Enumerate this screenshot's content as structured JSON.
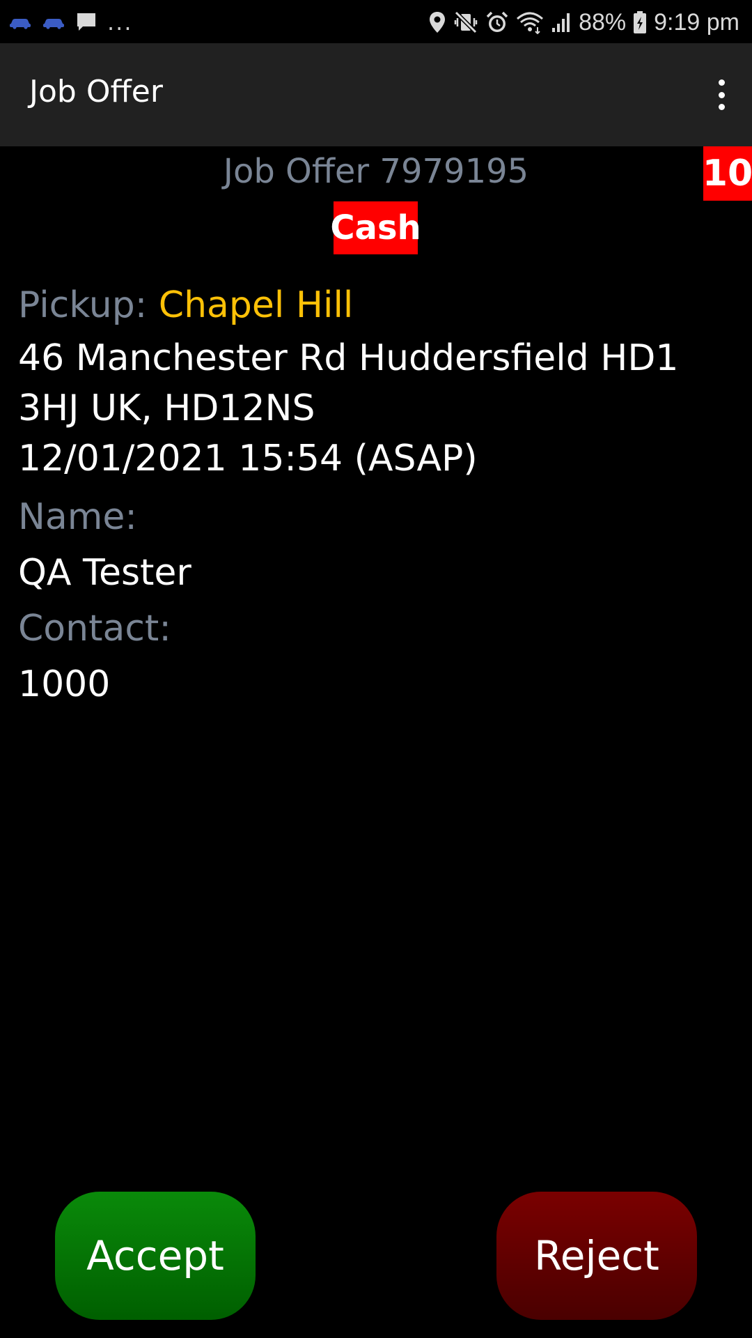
{
  "status_bar": {
    "left_icons": [
      "taxi-icon",
      "taxi-icon",
      "message-icon"
    ],
    "ellipsis": "...",
    "right_icons": [
      "location-icon",
      "vibrate-mute-icon",
      "alarm-icon",
      "wifi-icon",
      "signal-icon"
    ],
    "battery": "88%",
    "time": "9:19 pm"
  },
  "app_bar": {
    "title": "Job Offer",
    "menu_icon": "more-vertical-icon"
  },
  "offer": {
    "header": "Job Offer 7979195",
    "countdown": "10",
    "payment": "Cash"
  },
  "details": {
    "pickup_label": "Pickup:",
    "pickup_name": "Chapel Hill",
    "address_line1": "46 Manchester Rd Huddersfield HD1",
    "address_line2": "3HJ UK, HD12NS",
    "datetime": "12/01/2021 15:54 (ASAP)",
    "name_label": "Name:",
    "name_value": "QA Tester",
    "contact_label": "Contact:",
    "contact_value": "1000"
  },
  "actions": {
    "accept": "Accept",
    "reject": "Reject"
  },
  "colors": {
    "label": "#7a8595",
    "pickup_name": "#ffc107",
    "badge": "#ff0000",
    "accept": "#0a8a0a",
    "reject": "#7a0000",
    "app_bar": "#212121"
  }
}
